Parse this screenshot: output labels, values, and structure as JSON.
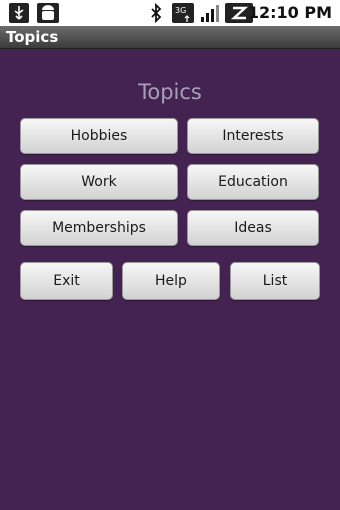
{
  "status_bar": {
    "time": "12:10 PM",
    "icons": [
      "usb-icon",
      "android-icon",
      "bluetooth-icon",
      "3g-icon",
      "signal-icon",
      "battery-icon"
    ]
  },
  "title_bar": {
    "title": "Topics"
  },
  "main": {
    "heading": "Topics",
    "buttons": [
      {
        "label": "Hobbies"
      },
      {
        "label": "Interests"
      },
      {
        "label": "Work"
      },
      {
        "label": "Education"
      },
      {
        "label": "Memberships"
      },
      {
        "label": "Ideas"
      }
    ],
    "actions": [
      {
        "label": "Exit"
      },
      {
        "label": "Help"
      },
      {
        "label": "List"
      }
    ]
  },
  "colors": {
    "background": "#442353",
    "heading_text": "#a7a0b8"
  }
}
